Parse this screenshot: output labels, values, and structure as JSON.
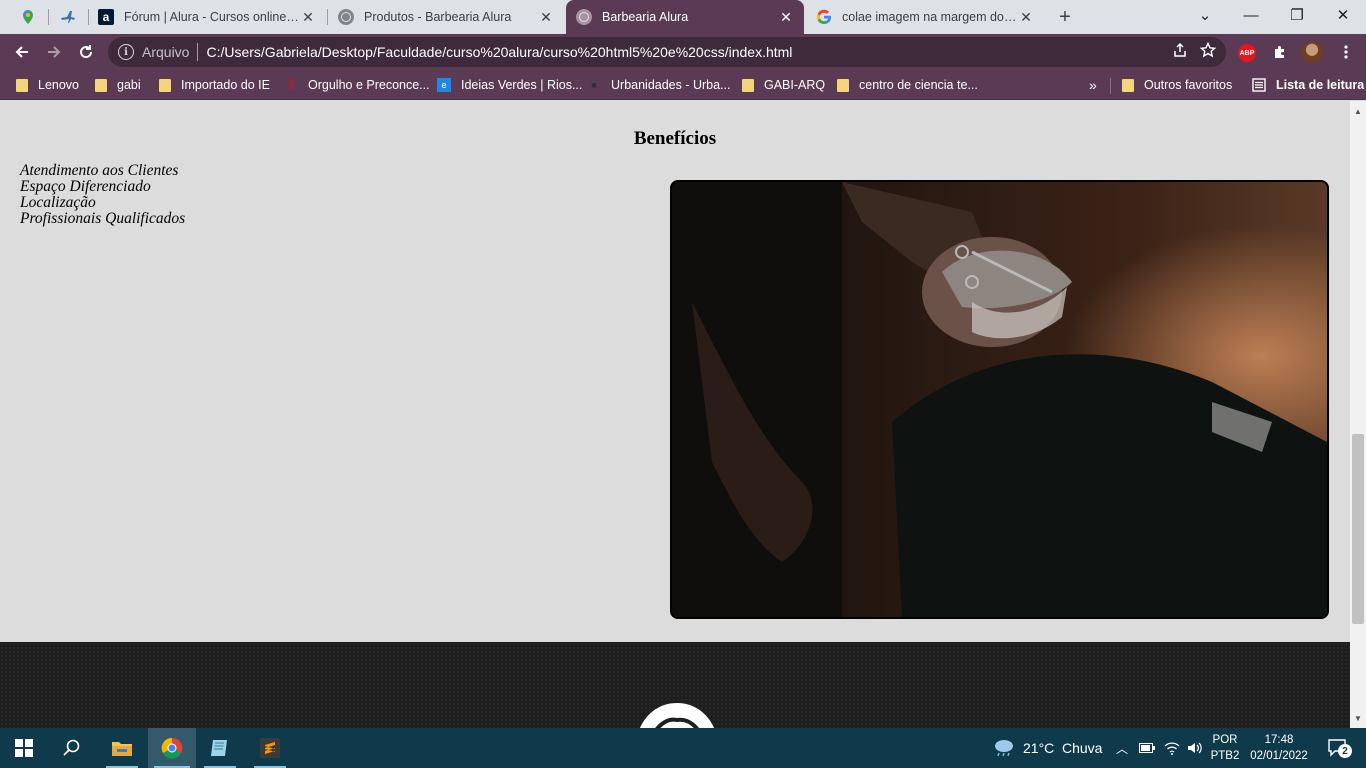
{
  "browser": {
    "tabs": [
      {
        "title": "",
        "icon": "maps-icon"
      },
      {
        "title": "",
        "icon": "plane-icon"
      },
      {
        "title": "Fórum | Alura - Cursos online de",
        "icon": "alura-icon"
      },
      {
        "title": "Produtos - Barbearia Alura",
        "icon": "globe-icon"
      },
      {
        "title": "Barbearia Alura",
        "icon": "globe-icon",
        "active": true
      },
      {
        "title": "colae imagem na margem do site",
        "icon": "google-icon"
      }
    ],
    "new_tab": "+",
    "window_controls": {
      "minimize": "—",
      "restore": "❐",
      "close": "✕",
      "tab_search": "⌄"
    },
    "omnibox": {
      "scheme_label": "Arquivo",
      "url": "C:/Users/Gabriela/Desktop/Faculdade/curso%20alura/curso%20html5%20e%20css/index.html"
    },
    "extensions": {
      "abp_label": "ABP"
    },
    "bookmarks": [
      {
        "label": "Lenovo",
        "icon": "folder-icon"
      },
      {
        "label": "gabi",
        "icon": "folder-icon"
      },
      {
        "label": "Importado do IE",
        "icon": "folder-icon"
      },
      {
        "label": "Orgulho e Preconce...",
        "icon": "book-icon"
      },
      {
        "label": "Ideias Verdes | Rios...",
        "icon": "ie-icon"
      },
      {
        "label": "Urbanidades - Urba...",
        "icon": "page-icon"
      },
      {
        "label": "GABI-ARQ",
        "icon": "folder-icon"
      },
      {
        "label": "centro de ciencia te...",
        "icon": "folder-icon"
      }
    ],
    "bookmarks_overflow": "»",
    "other_bookmarks": "Outros favoritos",
    "reading_list": "Lista de leitura"
  },
  "page": {
    "heading": "Benefícios",
    "benefits": [
      "Atendimento aos Clientes",
      "Espaço Diferenciado",
      "Localização",
      "Profissionais Qualificados"
    ],
    "image_alt": "Barbeiro aparando a barba de um cliente"
  },
  "taskbar": {
    "weather_temp": "21°C",
    "weather_desc": "Chuva",
    "lang_line1": "POR",
    "lang_line2": "PTB2",
    "time": "17:48",
    "date": "02/01/2022",
    "notifications": "2"
  },
  "colors": {
    "accent": "#5b3a55",
    "page_bg": "#dcdcdc",
    "taskbar": "#0f3a4b"
  }
}
